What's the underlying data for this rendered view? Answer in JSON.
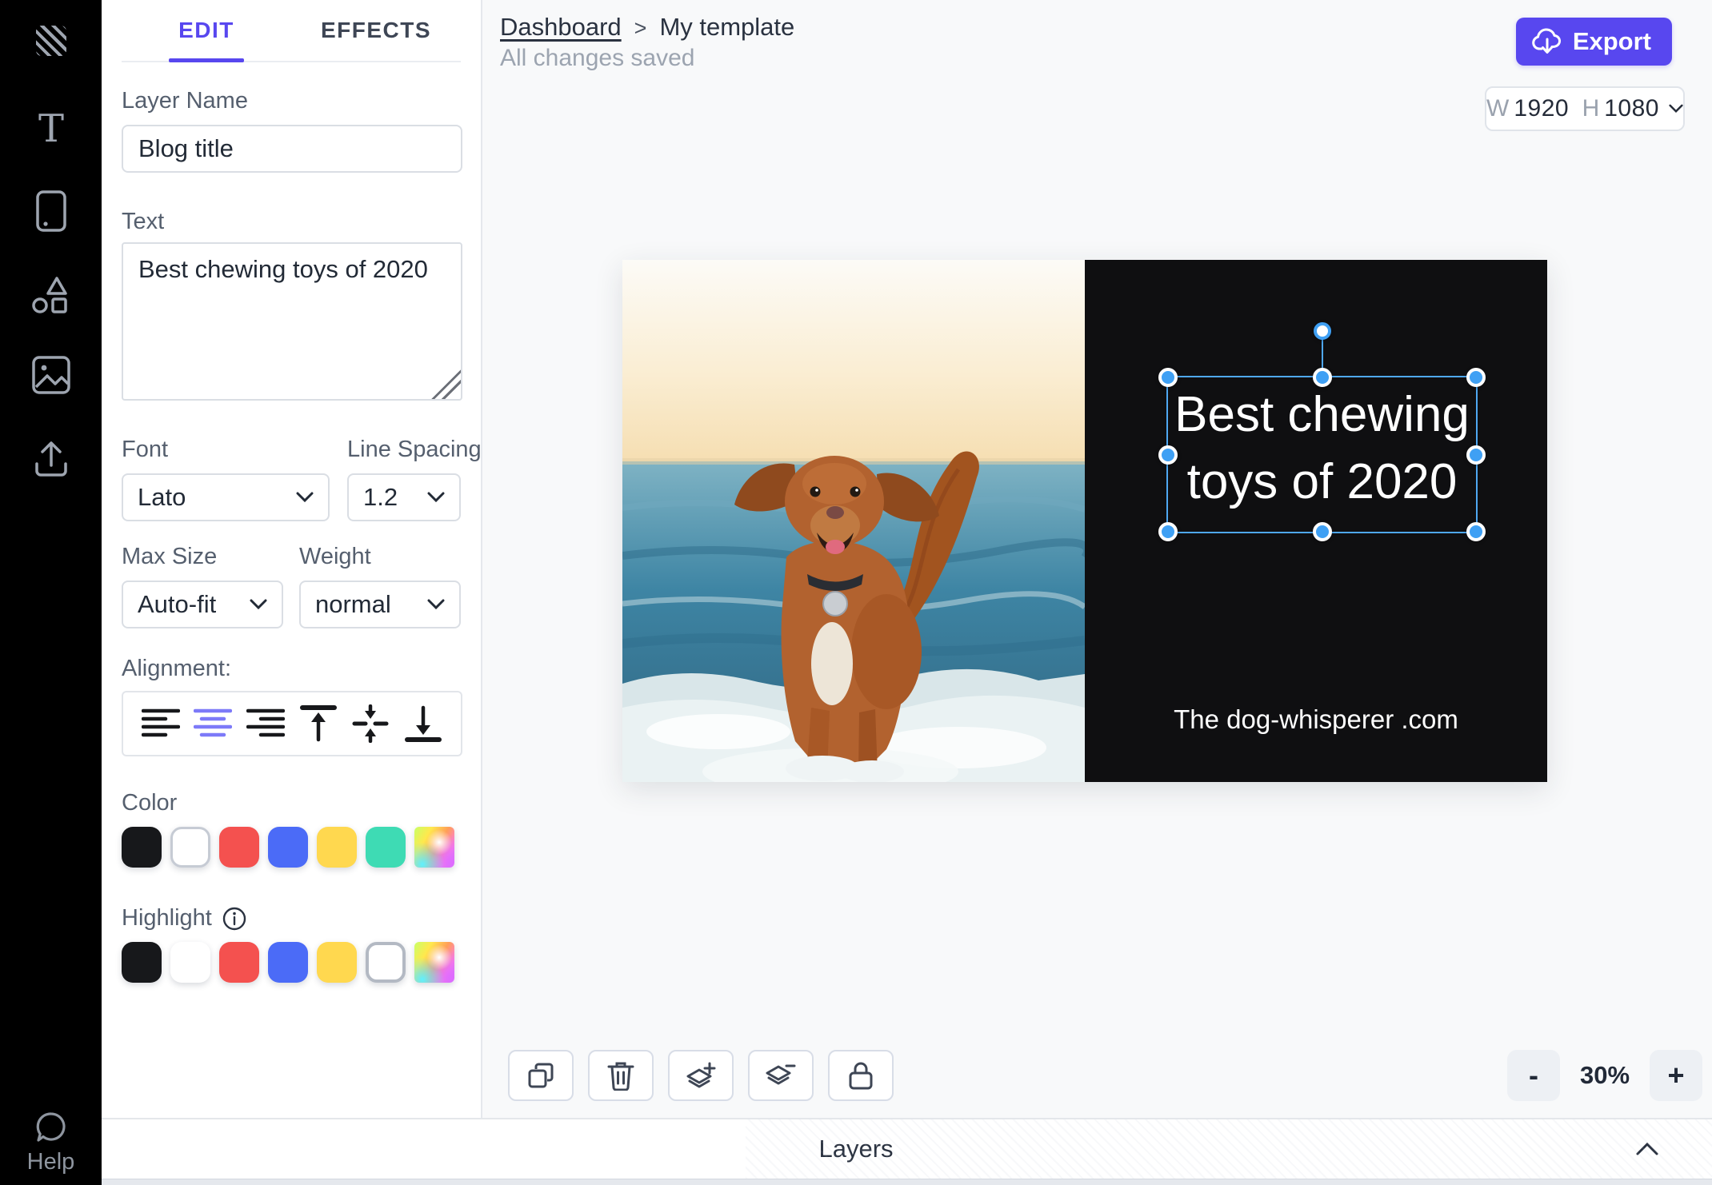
{
  "header": {
    "breadcrumb": {
      "home": "Dashboard",
      "separator": ">",
      "current": "My template"
    },
    "status": "All changes saved",
    "export_label": "Export",
    "size": {
      "w_label": "W",
      "w_value": "1920",
      "h_label": "H",
      "h_value": "1080"
    }
  },
  "sidebar": {
    "icons": [
      "logo-pattern",
      "text-tool",
      "mobile-preview",
      "shapes-tool",
      "image-tool",
      "upload-tool"
    ],
    "help_label": "Help"
  },
  "panel": {
    "tabs": {
      "edit": "EDIT",
      "effects": "EFFECTS"
    },
    "layer_name": {
      "label": "Layer Name",
      "value": "Blog title"
    },
    "text": {
      "label": "Text",
      "value": "Best chewing toys of 2020"
    },
    "font": {
      "label": "Font",
      "value": "Lato"
    },
    "line_spacing": {
      "label": "Line Spacing",
      "value": "1.2"
    },
    "max_size": {
      "label": "Max Size",
      "value": "Auto-fit"
    },
    "weight": {
      "label": "Weight",
      "value": "normal"
    },
    "alignment_label": "Alignment:",
    "alignment_options": [
      "align-left",
      "align-center",
      "align-right",
      "align-top",
      "align-middle",
      "align-bottom"
    ],
    "alignment_selected": "align-center",
    "color": {
      "label": "Color",
      "swatches": [
        {
          "name": "black",
          "style": "background:#17181B"
        },
        {
          "name": "white",
          "style": "background:#FFFFFF;border:3px solid #C6CBD4"
        },
        {
          "name": "red",
          "style": "background:#F4514F"
        },
        {
          "name": "blue",
          "style": "background:#4B6BF7"
        },
        {
          "name": "yellow",
          "style": "background:#FFD84F"
        },
        {
          "name": "teal",
          "style": "background:#3EDBB4"
        },
        {
          "name": "rainbow",
          "style": "border-radius:6px;background:radial-gradient(circle at 20% 92%, #5FF0FF 0%, rgba(95,240,255,0) 45%), radial-gradient(circle at 62% 38%, #FFFFFF 0%, rgba(255,255,255,0) 36%), radial-gradient(circle at 94% 88%, #DF6BFF 0%, rgba(223,107,255,0) 55%), linear-gradient(120deg,#C9FF66 0%,#FFE84D 28%,#FF9E57 55%,#FF7EE0 80%,#B97AFF 100%)"
        }
      ]
    },
    "highlight": {
      "label": "Highlight",
      "swatches": [
        {
          "name": "black",
          "style": "background:#17181B"
        },
        {
          "name": "white",
          "style": "background:#FFFFFF"
        },
        {
          "name": "red",
          "style": "background:#F4514F"
        },
        {
          "name": "blue",
          "style": "background:#4B6BF7"
        },
        {
          "name": "yellow",
          "style": "background:#FFD84F"
        },
        {
          "name": "none",
          "style": "background:#FFFFFF;border:4px solid #B3B9C3"
        },
        {
          "name": "rainbow",
          "style": "border-radius:6px;background:radial-gradient(circle at 20% 92%, #5FF0FF 0%, rgba(95,240,255,0) 45%), radial-gradient(circle at 62% 38%, #FFFFFF 0%, rgba(255,255,255,0) 36%), radial-gradient(circle at 94% 88%, #DF6BFF 0%, rgba(223,107,255,0) 55%), linear-gradient(120deg,#C9FF66 0%,#FFE84D 28%,#FF9E57 55%,#FF7EE0 80%,#B97AFF 100%)"
        }
      ]
    }
  },
  "canvas": {
    "title_line1": "Best chewing",
    "title_line2": "toys of 2020",
    "website": "The dog-whisperer .com",
    "photo_alt": "dog-on-beach-photo"
  },
  "toolbar": {
    "icons": [
      "duplicate",
      "delete",
      "bring-forward",
      "send-backward",
      "lock"
    ]
  },
  "zoom": {
    "minus": "-",
    "level": "30%",
    "plus": "+"
  },
  "layers_bar": {
    "label": "Layers"
  },
  "colors": {
    "accent": "#5847EF",
    "selection": "#3FA0F4",
    "canvas_panel": "#0F0F11",
    "sidebar_bg": "#000000"
  }
}
